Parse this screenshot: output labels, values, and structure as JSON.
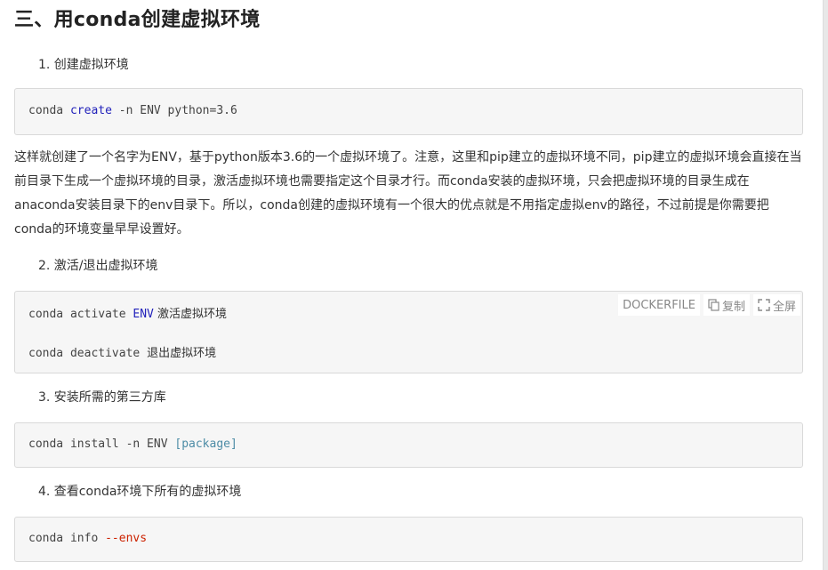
{
  "heading": "三、用conda创建虚拟环境",
  "steps": [
    "1. 创建虚拟环境",
    "2. 激活/退出虚拟环境",
    "3. 安装所需的第三方库",
    "4. 查看conda环境下所有的虚拟环境"
  ],
  "code1": {
    "a": "conda ",
    "kw": "create",
    "b": " -n ENV python=3.6"
  },
  "paragraph": "这样就创建了一个名字为ENV，基于python版本3.6的一个虚拟环境了。注意，这里和pip建立的虚拟环境不同，pip建立的虚拟环境会直接在当前目录下生成一个虚拟环境的目录，激活虚拟环境也需要指定这个目录才行。而conda安装的虚拟环境，只会把虚拟环境的目录生成在anaconda安装目录下的env目录下。所以，conda创建的虚拟环境有一个很大的优点就是不用指定虚拟env的路径，不过前提是你需要把conda的环境变量早早设置好。",
  "code2": {
    "toolbar": {
      "lang": "DOCKERFILE",
      "copy": "复制",
      "fullscreen": "全屏"
    },
    "line1": {
      "a": "conda activate ",
      "kw": "ENV",
      "cn": " 激活虚拟环境"
    },
    "line2": {
      "a": "conda deactivate ",
      "cn": "退出虚拟环境"
    }
  },
  "code3": {
    "a": "conda install -n ENV ",
    "kw": "[package]"
  },
  "code4": {
    "a": "conda info ",
    "kw": "--envs"
  },
  "colors": {
    "keyword_blue": "#2222bb",
    "keyword_teal": "#4d8ca6",
    "keyword_red": "#cc2200",
    "code_bg": "#f6f6f6"
  }
}
